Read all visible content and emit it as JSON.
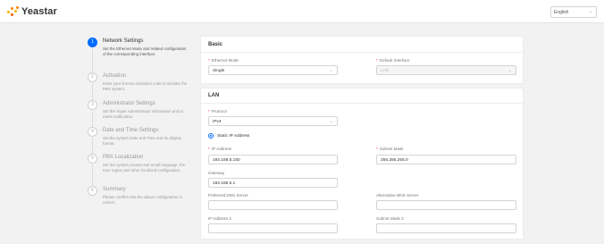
{
  "brand": {
    "name": "Yeastar",
    "color": "#ff8200",
    "icon": "yeastar-logo-icon"
  },
  "language": {
    "value": "English",
    "icon": "chevron-down-icon"
  },
  "steps": [
    {
      "number": "1",
      "title": "Network Settings",
      "description": "Set the Ethernet Mode and related configuration of the corresponding interface.",
      "status": "active"
    },
    {
      "number": "2",
      "title": "Activation",
      "description": "Enter your license activation code to activate the PBX system.",
      "status": "pending"
    },
    {
      "number": "3",
      "title": "Administrator Settings",
      "description": "Set the Super Administrator information and to event notification.",
      "status": "pending"
    },
    {
      "number": "4",
      "title": "Date and Time Settings",
      "description": "Set the system Date and Time and its display format.",
      "status": "pending"
    },
    {
      "number": "5",
      "title": "PBX Localization",
      "description": "Set the system prompt and email language, the tone region and other localized configuration.",
      "status": "pending"
    },
    {
      "number": "6",
      "title": "Summary",
      "description": "Please confirm that the above configuration is correct.",
      "status": "pending"
    }
  ],
  "basic": {
    "title": "Basic",
    "ethernet_mode": {
      "label": "Ethernet Mode",
      "value": "Single"
    },
    "default_interface": {
      "label": "Default Interface",
      "value": "LAN"
    }
  },
  "lan": {
    "title": "LAN",
    "protocol": {
      "label": "Protocol",
      "value": "IPv4"
    },
    "static_ip_label": "Static IP Address",
    "ip_address": {
      "label": "IP Address",
      "value": "192.168.5.150"
    },
    "subnet_mask": {
      "label": "Subnet Mask",
      "value": "255.255.255.0"
    },
    "gateway": {
      "label": "Gateway",
      "value": "192.168.5.1"
    },
    "preferred_dns": {
      "label": "Preferred DNS Server",
      "value": ""
    },
    "alternative_dns": {
      "label": "Alternative DNS Server",
      "value": ""
    },
    "ip_address_2": {
      "label": "IP Address 2",
      "value": ""
    },
    "subnet_mask_2": {
      "label": "Subnet Mask 2",
      "value": ""
    }
  },
  "colors": {
    "accent": "#006cff",
    "required": "#f5222d",
    "background": "#f2f2f2"
  }
}
